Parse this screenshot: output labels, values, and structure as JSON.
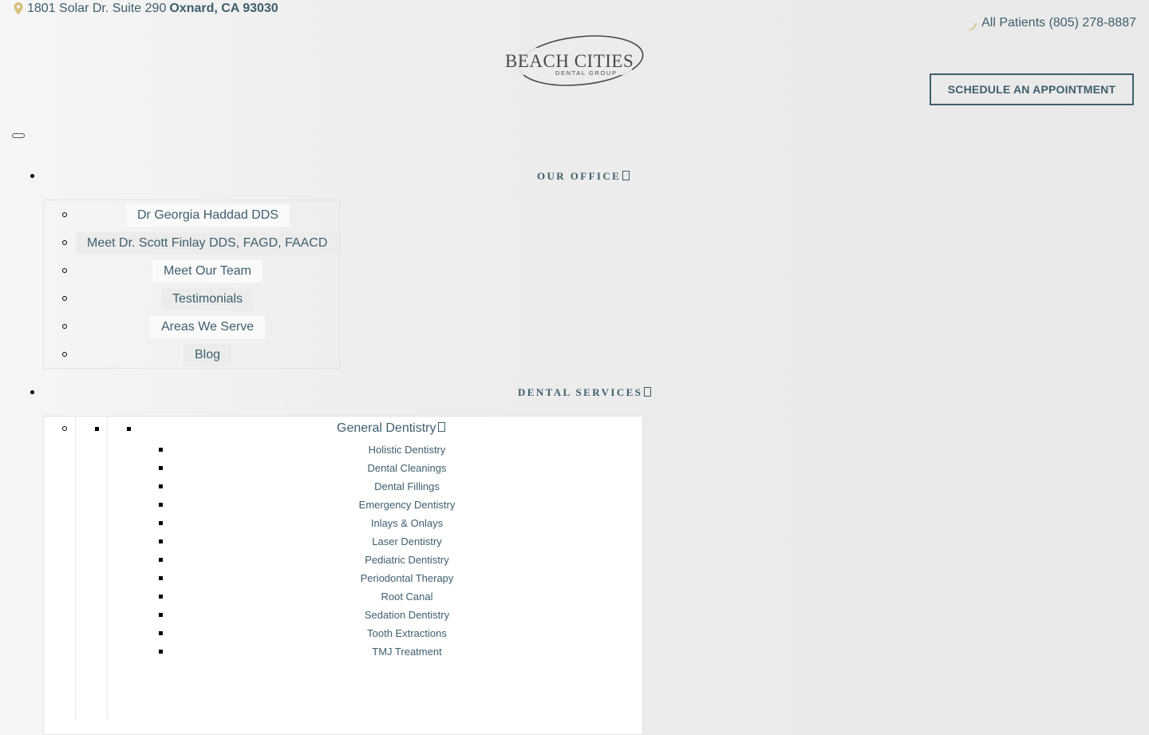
{
  "header": {
    "address_street": "1801 Solar Dr. Suite 290",
    "address_city": "Oxnard, CA 93030",
    "phone_label": "All Patients (805) 278-8887",
    "schedule_button": "SCHEDULE AN APPOINTMENT",
    "logo_name": "BEACH CITIES",
    "logo_sub": "DENTAL GROUP",
    "accent_color": "#3d5f6e",
    "icon_color": "#d8c07a"
  },
  "nav": {
    "our_office": {
      "label": "OUR OFFICE",
      "items": [
        "Dr Georgia Haddad DDS",
        "Meet Dr. Scott Finlay DDS, FAGD, FAACD",
        "Meet Our Team",
        "Testimonials",
        "Areas We Serve",
        "Blog"
      ]
    },
    "dental_services": {
      "label": "DENTAL SERVICES",
      "general": {
        "label": "General Dentistry",
        "items": [
          "Holistic Dentistry",
          "Dental Cleanings",
          "Dental Fillings",
          "Emergency Dentistry",
          "Inlays & Onlays",
          "Laser Dentistry",
          "Pediatric Dentistry",
          "Periodontal Therapy",
          "Root Canal",
          "Sedation Dentistry",
          "Tooth Extractions",
          "TMJ Treatment"
        ]
      }
    }
  }
}
